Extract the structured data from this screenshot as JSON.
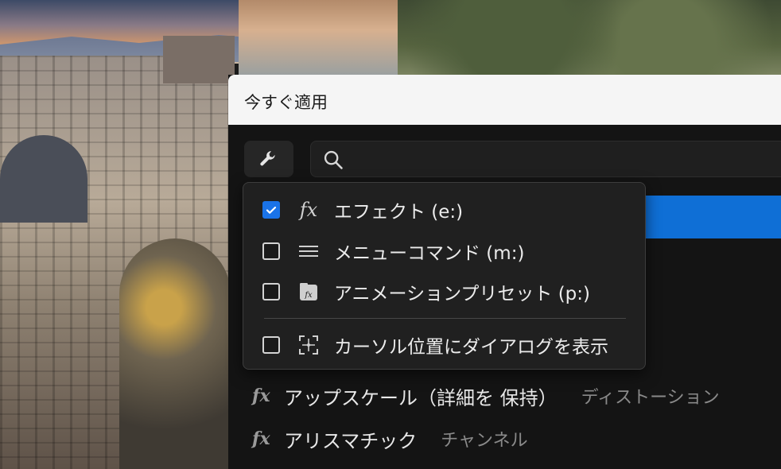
{
  "dialog": {
    "title": "今すぐ適用",
    "search_placeholder": ""
  },
  "filter_menu": {
    "items": [
      {
        "label": "エフェクト (e:)",
        "checked": true,
        "icon": "fx-icon"
      },
      {
        "label": "メニューコマンド (m:)",
        "checked": false,
        "icon": "menu-lines-icon"
      },
      {
        "label": "アニメーションプリセット (p:)",
        "checked": false,
        "icon": "preset-icon"
      },
      {
        "label": "カーソル位置にダイアログを表示",
        "checked": false,
        "icon": "cursor-position-icon"
      }
    ]
  },
  "results": [
    {
      "icon": "fx",
      "name": "アップスケール（詳細を 保持）",
      "category": "ディストーション"
    },
    {
      "icon": "fx",
      "name": "アリスマチック",
      "category": "チャンネル"
    }
  ],
  "colors": {
    "selection": "#0f6fd6",
    "checkbox_checked": "#1a73e8",
    "dialog_bg": "#141414",
    "titlebar_bg": "#f5f5f5"
  }
}
